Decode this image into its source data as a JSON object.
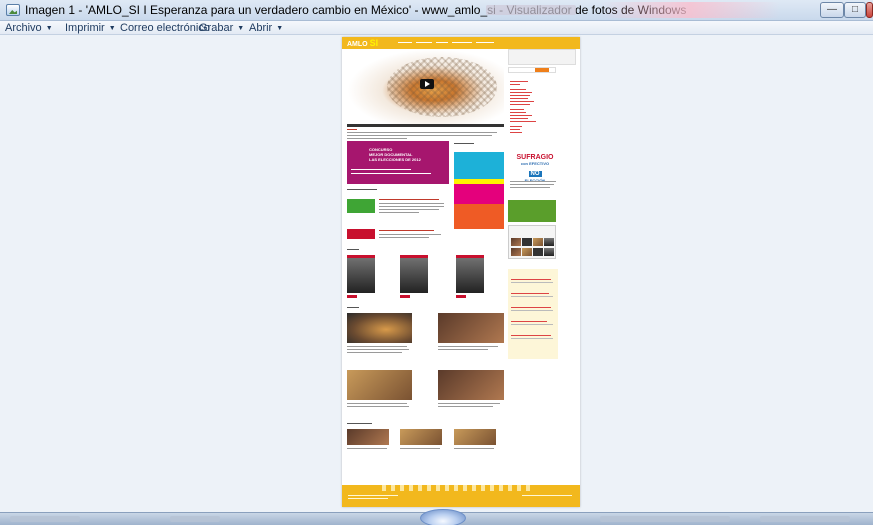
{
  "window": {
    "title": "Imagen 1 - 'AMLO_SI I Esperanza para un verdadero cambio en México' - www_amlo_si - Visualizador de fotos de Windows",
    "minimize_label": "—",
    "maximize_label": "□"
  },
  "menu": {
    "items": [
      {
        "label": "Archivo"
      },
      {
        "label": "Imprimir"
      },
      {
        "label": "Correo electrónico"
      },
      {
        "label": "Grabar"
      },
      {
        "label": "Abrir"
      }
    ]
  },
  "photo": {
    "logo_text": "AMLO",
    "logo_mark": "SI",
    "sufragio": {
      "line1": "SUFRAGIO",
      "line2": "con EFECTIVO",
      "line3": "NO",
      "line4": "ELECCIÓN"
    },
    "magenta_lines": [
      "CONCURSO",
      "MEJOR DOCUMENTAL",
      "LAS ELECCIONES DE 2012"
    ]
  },
  "colors": {
    "site_header": "#f2b81d",
    "magenta_banner": "#a6166e",
    "accent_red": "#c8102e",
    "cyan_banner": "#1db1d8",
    "green": "#3fa535"
  }
}
